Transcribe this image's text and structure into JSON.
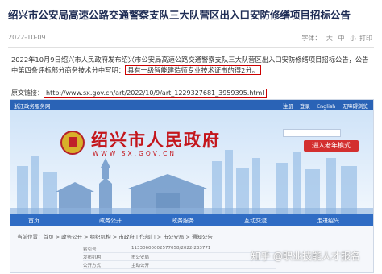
{
  "article": {
    "title": "绍兴市公安局高速公路交通警察支队三大队营区出入口安防修缮项目招标公告",
    "date": "2022-10-09",
    "font_label": "字体：",
    "font_sizes": [
      "大",
      "中",
      "小"
    ],
    "print_label": "打印",
    "para1": "2022年10月9日绍兴市人民政府发布绍兴市公安局高速公路交通警察支队三大队营区出入口安防修缮项目招标公告，公告中第四条评标部分商务技术分中写明：",
    "para1_highlight": "具有一级智能建造师专业技术证书的得2分。",
    "link_label": "原文链接：",
    "link_url": "http://www.sx.gov.cn/art/2022/10/9/art_1229327681_3959395.html"
  },
  "screenshot": {
    "topbar_left": "浙江政务服务网",
    "topbar_right": [
      "注册",
      "登录",
      "English",
      "无障碍浏览"
    ],
    "gov_name": "绍兴市人民政府",
    "gov_url": "WWW.SX.GOV.CN",
    "elder_button": "进入老年模式",
    "nav": [
      "首页",
      "政务公开",
      "政务服务",
      "互动交流",
      "走进绍兴"
    ],
    "breadcrumb": "当前位置：首页 > 政务公开 > 组织机构 > 市政府工作部门 > 市公安局 > 通知公告",
    "detail_rows": [
      {
        "k": "索引号",
        "v": "11330600002577058/2022-233771"
      },
      {
        "k": "发布机构",
        "v": "市公安局"
      },
      {
        "k": "公开方式",
        "v": "主动公开"
      }
    ]
  },
  "watermark": "知乎 @职业技能人才报名"
}
